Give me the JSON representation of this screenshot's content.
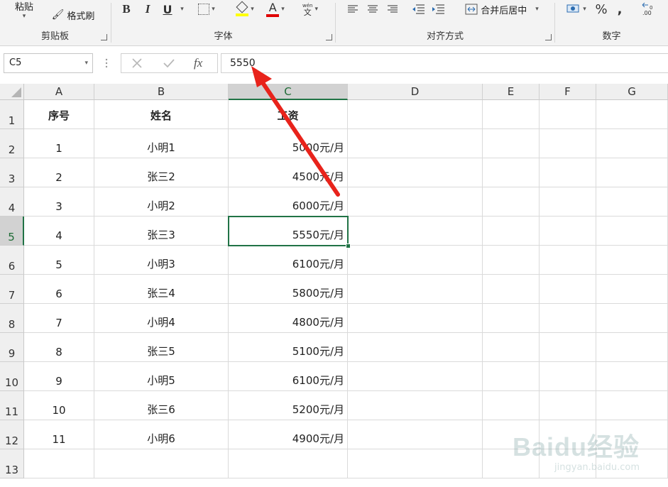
{
  "ribbon": {
    "clipboard": {
      "paste_label": "粘贴",
      "format_painter_label": "格式刷",
      "group_label": "剪贴板"
    },
    "font": {
      "group_label": "字体",
      "bold": "B",
      "italic": "I",
      "underline": "U",
      "font_color_glyph": "A",
      "phonetic_glyph": "文",
      "phonetic_top": "wén"
    },
    "alignment": {
      "merge_center_label": "合并后居中",
      "group_label": "对齐方式"
    },
    "number": {
      "percent": "%",
      "comma": ",",
      "group_label": "数字"
    }
  },
  "formula_bar": {
    "name_box": "C5",
    "fx": "fx",
    "value": "5550"
  },
  "columns": [
    "A",
    "B",
    "C",
    "D",
    "E",
    "F",
    "G"
  ],
  "rows": [
    {
      "num": "1",
      "a": "序号",
      "b": "姓名",
      "c": "工资"
    },
    {
      "num": "2",
      "a": "1",
      "b": "小明1",
      "c": "5000元/月"
    },
    {
      "num": "3",
      "a": "2",
      "b": "张三2",
      "c": "4500元/月"
    },
    {
      "num": "4",
      "a": "3",
      "b": "小明2",
      "c": "6000元/月"
    },
    {
      "num": "5",
      "a": "4",
      "b": "张三3",
      "c": "5550元/月"
    },
    {
      "num": "6",
      "a": "5",
      "b": "小明3",
      "c": "6100元/月"
    },
    {
      "num": "7",
      "a": "6",
      "b": "张三4",
      "c": "5800元/月"
    },
    {
      "num": "8",
      "a": "7",
      "b": "小明4",
      "c": "4800元/月"
    },
    {
      "num": "9",
      "a": "8",
      "b": "张三5",
      "c": "5100元/月"
    },
    {
      "num": "10",
      "a": "9",
      "b": "小明5",
      "c": "6100元/月"
    },
    {
      "num": "11",
      "a": "10",
      "b": "张三6",
      "c": "5200元/月"
    },
    {
      "num": "12",
      "a": "11",
      "b": "小明6",
      "c": "4900元/月"
    },
    {
      "num": "13",
      "a": "",
      "b": "",
      "c": ""
    }
  ],
  "selected_cell": "C5",
  "colors": {
    "selection": "#217346",
    "arrow": "#e8231b",
    "font_color": "#e00000",
    "highlight": "#ffff00"
  },
  "watermark": {
    "brand": "Baidu经验",
    "url": "jingyan.baidu.com"
  }
}
